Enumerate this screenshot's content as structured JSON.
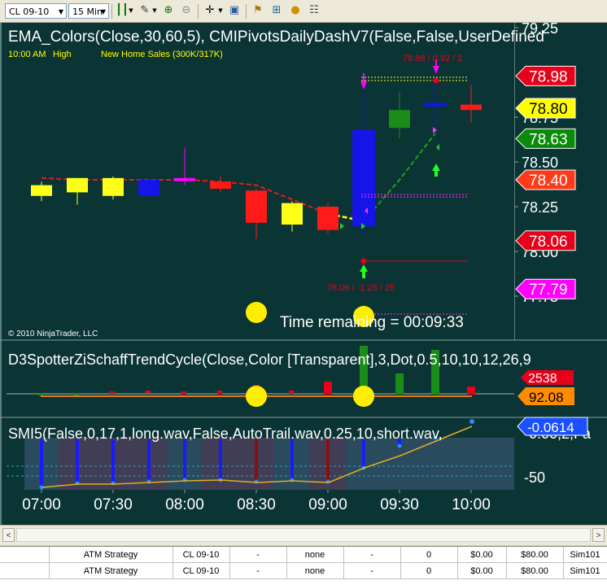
{
  "toolbar": {
    "instrument": "CL 09-10",
    "interval": "15 Min",
    "icons": [
      "bar-type-icon",
      "drawing-pen-icon",
      "zoom-in-icon",
      "zoom-out-icon",
      "crosshair-icon",
      "properties-icon",
      "strategies-icon",
      "indicators-icon",
      "ninja-coin-icon",
      "data-box-icon"
    ]
  },
  "chart_data": [
    {
      "type": "candlestick",
      "title": "EMA_Colors(Close,30,60,5),  CMIPivotsDailyDashV7(False,False,UserDefined",
      "x_ticks": [
        "07:00",
        "07:30",
        "08:00",
        "08:30",
        "09:00",
        "09:30",
        "10:00"
      ],
      "y_ticks": [
        "79.25",
        "78.75",
        "78.50",
        "78.25",
        "78.00",
        "77.75"
      ],
      "ylim": [
        77.73,
        79.25
      ],
      "candles": [
        {
          "t": "06:45",
          "o": 78.31,
          "h": 78.39,
          "l": 78.28,
          "c": 78.37,
          "color": "#ffff1a"
        },
        {
          "t": "07:00",
          "o": 78.33,
          "h": 78.41,
          "l": 78.26,
          "c": 78.41,
          "color": "#ffff1a"
        },
        {
          "t": "07:15",
          "o": 78.31,
          "h": 78.42,
          "l": 78.29,
          "c": 78.41,
          "color": "#ffff1a"
        },
        {
          "t": "07:30",
          "o": 78.4,
          "h": 78.41,
          "l": 78.3,
          "c": 78.31,
          "color": "#1515e8"
        },
        {
          "t": "07:45",
          "o": 78.41,
          "h": 78.58,
          "l": 78.37,
          "c": 78.4,
          "color": "#ff00ff"
        },
        {
          "t": "08:00",
          "o": 78.39,
          "h": 78.42,
          "l": 78.33,
          "c": 78.35,
          "color": "#ff1a1a"
        },
        {
          "t": "08:15",
          "o": 78.34,
          "h": 78.35,
          "l": 78.07,
          "c": 78.16,
          "color": "#ff1a1a"
        },
        {
          "t": "08:30",
          "o": 78.15,
          "h": 78.28,
          "l": 78.11,
          "c": 78.27,
          "color": "#ffff1a"
        },
        {
          "t": "08:45",
          "o": 78.25,
          "h": 78.27,
          "l": 78.1,
          "c": 78.12,
          "color": "#ff1a1a"
        },
        {
          "t": "09:00",
          "o": 78.14,
          "h": 78.9,
          "l": 78.09,
          "c": 78.68,
          "color": "#1515e8"
        },
        {
          "t": "09:15",
          "o": 78.69,
          "h": 78.89,
          "l": 78.63,
          "c": 78.79,
          "color": "#1a8c1a"
        },
        {
          "t": "09:30",
          "o": 78.83,
          "h": 78.98,
          "l": 78.68,
          "c": 78.81,
          "color": "#1515e8"
        },
        {
          "t": "09:45",
          "o": 78.82,
          "h": 78.93,
          "l": 78.72,
          "c": 78.79,
          "color": "#ff1a1a"
        }
      ],
      "ema_line": [
        78.41,
        78.4,
        78.4,
        78.4,
        78.4,
        78.39,
        78.37,
        78.29,
        78.21,
        78.17,
        78.4,
        78.66
      ],
      "price_labels": [
        {
          "text": "78.98",
          "value": 78.98,
          "bg": "#e8001a",
          "fg": "#ffffff"
        },
        {
          "text": "78.80",
          "value": 78.8,
          "bg": "#ffff00",
          "fg": "#000000"
        },
        {
          "text": "78.63",
          "value": 78.63,
          "bg": "#0a8c0a",
          "fg": "#ffffff"
        },
        {
          "text": "78.40",
          "value": 78.4,
          "bg": "#ff3a1a",
          "fg": "#ffffff"
        },
        {
          "text": "78.06",
          "value": 78.06,
          "bg": "#e8001a",
          "fg": "#ffffff"
        },
        {
          "text": "77.79",
          "value": 77.79,
          "bg": "#ff00ff",
          "fg": "#ffffff"
        }
      ],
      "annotations": {
        "session_note_time": "10:00 AM",
        "session_note_level": "High",
        "news": "New Home Sales (300K/317K)",
        "high_label": "78.98 / 0.92 / 2",
        "low_label": "78.06 / -1.25 / 25",
        "timer": "Time remaining = 00:09:33",
        "copyright": "© 2010 NinjaTrader, LLC"
      },
      "legend": "none",
      "grid": false
    },
    {
      "type": "bar",
      "title": "D3SpotterZiSchaffTrendCycle(Close,Color [Transparent],3,Dot,0.5,10,10,12,26,9",
      "right_labels": [
        {
          "text": "2538",
          "bg": "#e8001a",
          "fg": "#ffffff"
        },
        {
          "text": "92.08",
          "bg": "#ff8c00",
          "fg": "#000000"
        }
      ]
    },
    {
      "type": "bar",
      "title": "SMI5(False,0,17,1,long.wav,False,AutoTrail.wav,0.25,10,short.wav,",
      "title_tail": "0.00,2,Fa",
      "y_ticks": [
        "-50"
      ],
      "right_labels": [
        {
          "text": "-0.0614",
          "bg": "#1a50ff",
          "fg": "#ffffff"
        }
      ]
    }
  ],
  "scrollbar": {
    "left_arrow": "<",
    "right_arrow": ">"
  },
  "atm_rows": [
    [
      "",
      "ATM Strategy",
      "CL 09-10",
      "-",
      "none",
      "-",
      "0",
      "$0.00",
      "$80.00",
      "Sim101"
    ],
    [
      "",
      "ATM Strategy",
      "CL 09-10",
      "-",
      "none",
      "-",
      "0",
      "$0.00",
      "$80.00",
      "Sim101"
    ]
  ]
}
